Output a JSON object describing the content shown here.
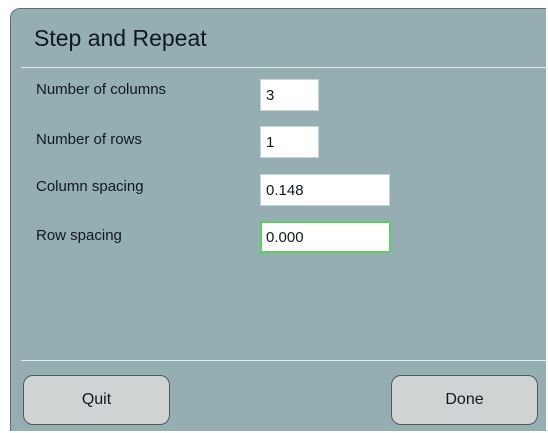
{
  "dialog": {
    "title": "Step and Repeat"
  },
  "fields": {
    "columns": {
      "label": "Number of columns",
      "value": "3"
    },
    "rows": {
      "label": "Number of rows",
      "value": "1"
    },
    "column_spacing": {
      "label": "Column spacing",
      "value": "0.148"
    },
    "row_spacing": {
      "label": "Row spacing",
      "value": "0.000"
    }
  },
  "buttons": {
    "quit_label": "Quit",
    "done_label": "Done"
  },
  "colors": {
    "dialog_background": "#94aeb1",
    "focus_border": "#5bd060",
    "button_background": "#cfd3d3"
  }
}
